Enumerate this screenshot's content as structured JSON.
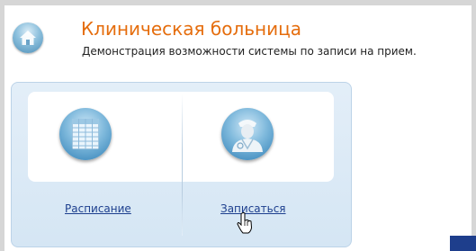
{
  "header": {
    "title": "Клиническая больница",
    "subtitle": "Демонстрация возможности системы по записи на прием.",
    "icon": "home-icon"
  },
  "actions": [
    {
      "label": "Расписание",
      "icon": "calendar-table-icon"
    },
    {
      "label": "Записаться",
      "icon": "doctor-icon"
    }
  ],
  "colors": {
    "title": "#e56d0d",
    "link": "#1d3f8e",
    "panel_background": "#d5e6f4"
  }
}
